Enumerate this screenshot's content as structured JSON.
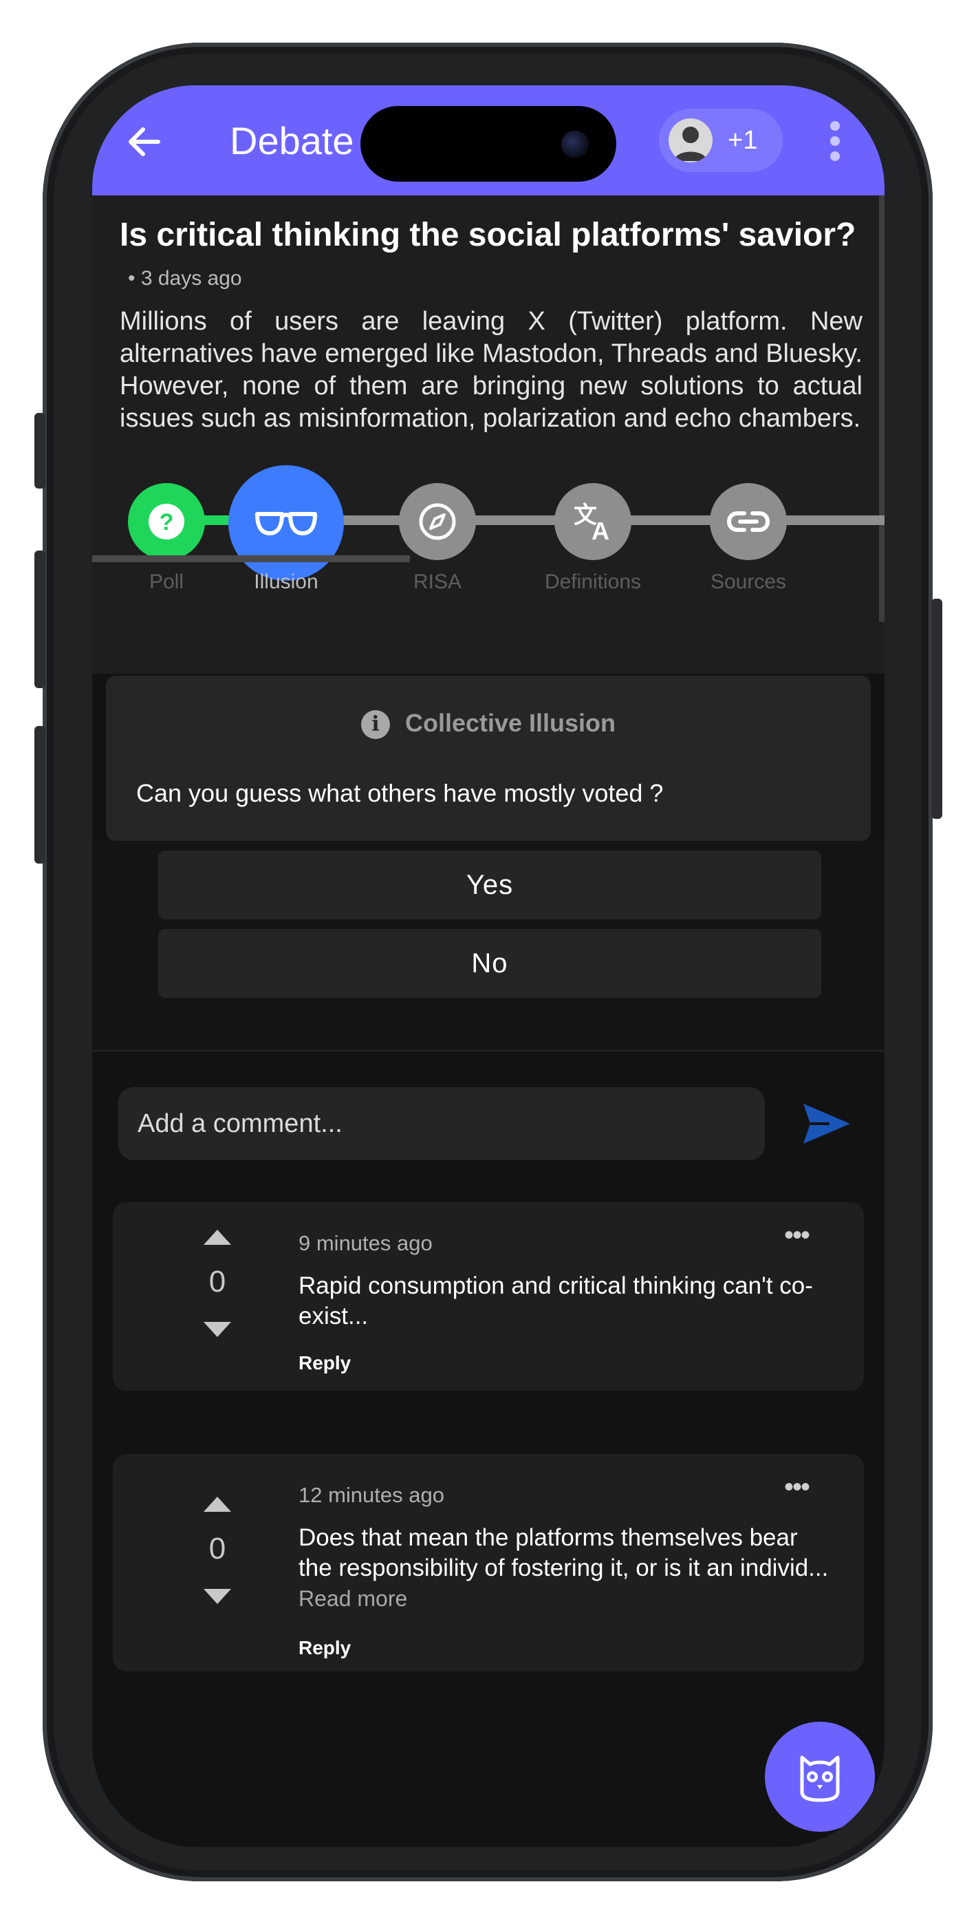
{
  "appbar": {
    "title": "Debate",
    "participants_extra": "+1",
    "color": "#6c63ff"
  },
  "debate": {
    "title": "Is critical thinking the social platforms' savior?",
    "time": "• 3 days ago",
    "body": "Millions of users are leaving X (Twitter) platform. New alternatives have emerged like Mastodon, Threads and Bluesky. However, none of them are bringing new solutions to actual issues such as misinformation, polarization and echo chambers."
  },
  "steps": [
    {
      "label": "Poll",
      "icon": "question-icon",
      "color": "#1fd65a"
    },
    {
      "label": "Illusion",
      "icon": "glasses-icon",
      "color": "#3d7bff",
      "active": true
    },
    {
      "label": "RISA",
      "icon": "compass-icon",
      "color": "#8e8e8e"
    },
    {
      "label": "Definitions",
      "icon": "translate-icon",
      "color": "#8e8e8e"
    },
    {
      "label": "Sources",
      "icon": "link-icon",
      "color": "#8e8e8e"
    }
  ],
  "illusion": {
    "heading": "Collective Illusion",
    "question": "Can you guess what others have mostly voted ?",
    "options": [
      "Yes",
      "No"
    ]
  },
  "comment_box": {
    "placeholder": "Add a comment...",
    "send_color": "#1a56b8"
  },
  "comments": [
    {
      "score": "0",
      "time": "9 minutes ago",
      "text": "Rapid consumption and critical thinking can't co-exist...",
      "read_more": "",
      "reply": "Reply"
    },
    {
      "score": "0",
      "time": "12 minutes ago",
      "text": "Does that mean the platforms themselves bear the responsibility of fostering it, or is it an individ...",
      "read_more": "Read more",
      "reply": "Reply"
    }
  ],
  "more_menu": "•••"
}
